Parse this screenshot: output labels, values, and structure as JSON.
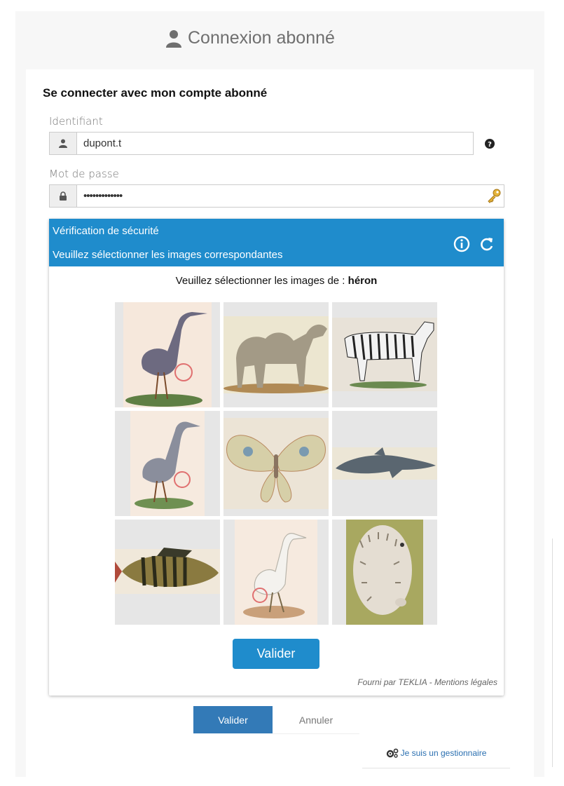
{
  "header": {
    "title": "Connexion abonné",
    "icon": "user-icon"
  },
  "form": {
    "subtitle": "Se connecter avec mon compte abonné",
    "username_label": "Identifiant",
    "username_value": "dupont.t",
    "password_label": "Mot de passe",
    "password_value": "•••••••••••••",
    "help_icon": "question-circle-icon",
    "password_manager_icon": "key-icon"
  },
  "captcha": {
    "title": "Vérification de sécurité",
    "instruction": "Veuillez sélectionner les images correspondantes",
    "prompt_prefix": "Veuillez sélectionner les images de :",
    "prompt_target": "héron",
    "tiles": [
      "heron-image",
      "camel-image",
      "zebra-image",
      "heron-image",
      "moth-image",
      "dolphin-image",
      "perch-image",
      "egret-image",
      "hedgehog-image"
    ],
    "submit_label": "Valider",
    "credit": "Fourni par TEKLIA - Mentions légales",
    "accent_color": "#1f8ccc"
  },
  "actions": {
    "submit_label": "Valider",
    "cancel_label": "Annuler"
  },
  "footer": {
    "manager_link": "Je suis un gestionnaire"
  }
}
